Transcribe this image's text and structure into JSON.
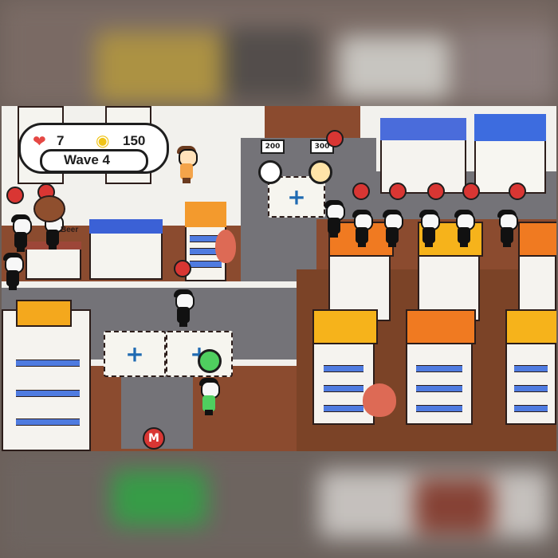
{
  "hud": {
    "lives": "7",
    "coins": "150",
    "wave": "Wave 4",
    "heart_icon": "heart-icon",
    "coin_icon": "coin-stack-icon"
  },
  "towers": {
    "cost_left": "200",
    "cost_right": "300"
  },
  "labels": {
    "beer_sign": "Beer",
    "marker_letter": "M"
  },
  "colors": {
    "accent_blue": "#1f6ab2",
    "danger_red": "#d93633",
    "selected_green": "#4fcf5f"
  }
}
